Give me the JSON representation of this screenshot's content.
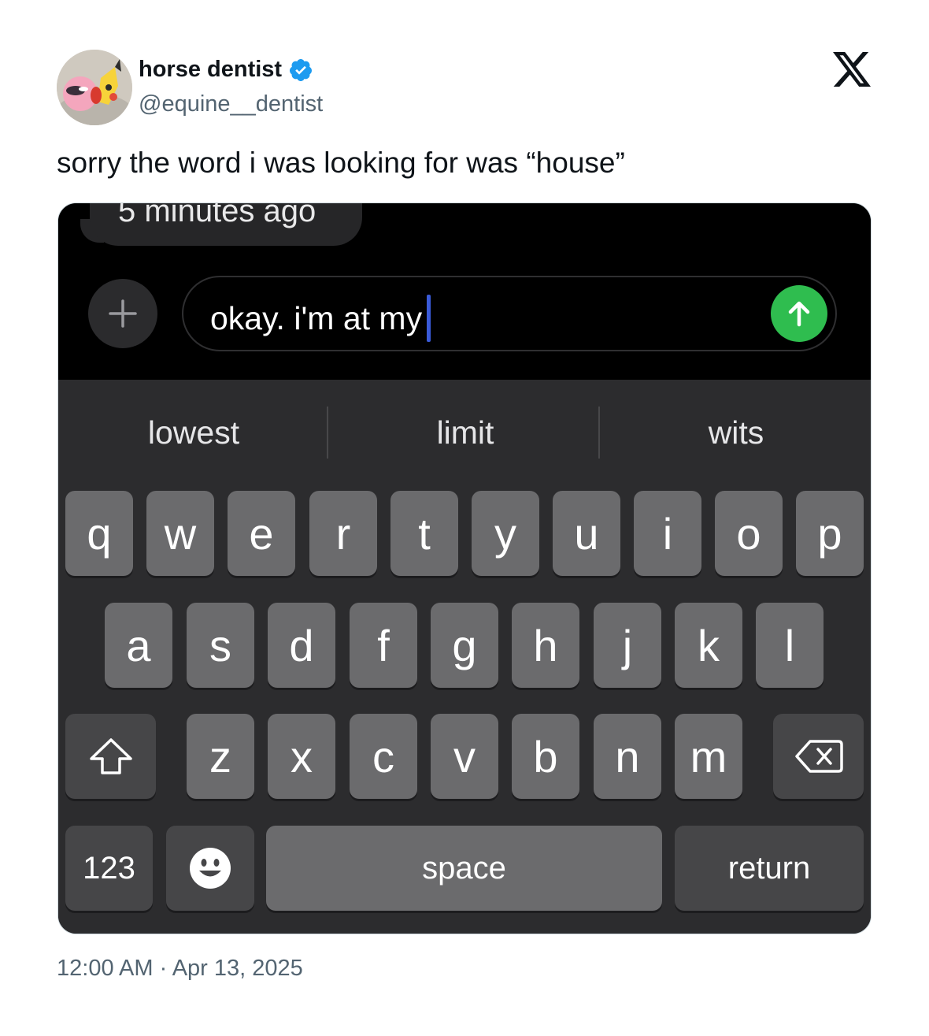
{
  "author": {
    "name": "horse dentist",
    "handle": "@equine__dentist",
    "verified": true
  },
  "tweet": {
    "text": "sorry the word i was looking for was “house”",
    "timestamp": "12:00 AM · Apr 13, 2025"
  },
  "platform_icon": "x-logo-icon",
  "screenshot": {
    "previous_message_time": "5 minutes ago",
    "input_text": "okay. i'm at my",
    "suggestions": [
      "lowest",
      "limit",
      "wits"
    ],
    "rows": [
      [
        "q",
        "w",
        "e",
        "r",
        "t",
        "y",
        "u",
        "i",
        "o",
        "p"
      ],
      [
        "a",
        "s",
        "d",
        "f",
        "g",
        "h",
        "j",
        "k",
        "l"
      ],
      [
        "z",
        "x",
        "c",
        "v",
        "b",
        "n",
        "m"
      ]
    ],
    "numbers_key": "123",
    "space_key": "space",
    "return_key": "return",
    "send_color": "#2fbd4f",
    "caret_color": "#3a5bd9"
  },
  "colors": {
    "verified_blue": "#1d9bf0",
    "secondary_text": "#536471"
  }
}
